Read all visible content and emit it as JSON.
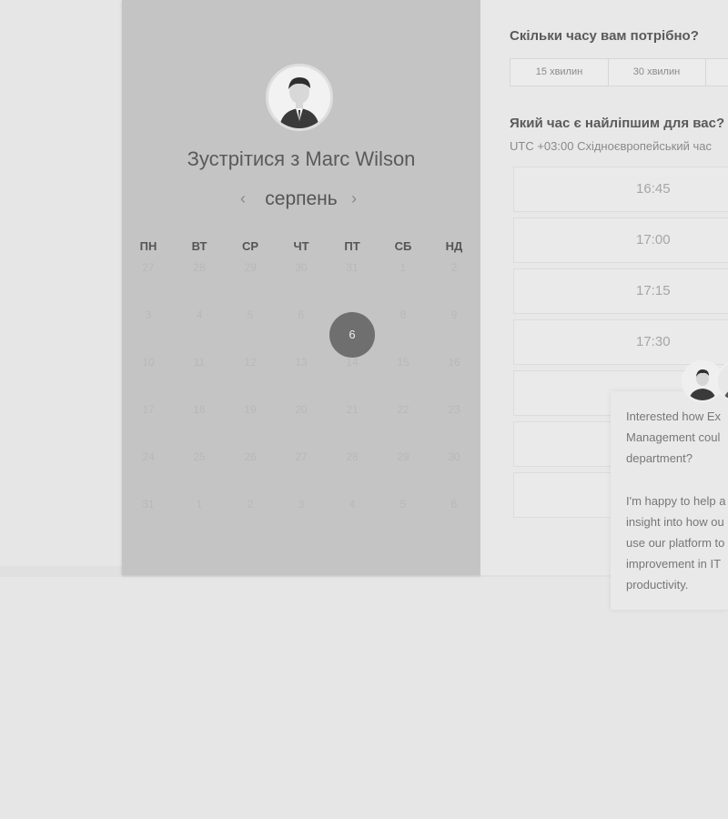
{
  "host": {
    "title": "Зустрітися з Marc Wilson"
  },
  "calendar": {
    "prev_symbol": "‹",
    "next_symbol": "›",
    "month": "серпень",
    "weekdays": [
      "ПН",
      "ВТ",
      "СР",
      "ЧТ",
      "ПТ",
      "СБ",
      "НД"
    ],
    "weeks": [
      [
        "27",
        "28",
        "29",
        "30",
        "31",
        "1",
        "2"
      ],
      [
        "3",
        "4",
        "5",
        "6",
        "7",
        "8",
        "9"
      ],
      [
        "10",
        "11",
        "12",
        "13",
        "14",
        "15",
        "16"
      ],
      [
        "17",
        "18",
        "19",
        "20",
        "21",
        "22",
        "23"
      ],
      [
        "24",
        "25",
        "26",
        "27",
        "28",
        "29",
        "30"
      ],
      [
        "31",
        "1",
        "2",
        "3",
        "4",
        "5",
        "6"
      ]
    ],
    "selected_day": "6"
  },
  "booking": {
    "duration_question": "Скільки часу вам потрібно?",
    "durations": [
      "15 хвилин",
      "30 хвилин"
    ],
    "time_question": "Який час є найліпшим для вас?",
    "timezone": "UTC +03:00 Східноєвропейський час",
    "slots": [
      "16:45",
      "17:00",
      "17:15",
      "17:30"
    ]
  },
  "chat": {
    "lines": [
      "Interested how Ex",
      "Management coul",
      "department?",
      "I'm happy to help a",
      "insight into how ou",
      "use our platform to",
      "improvement in IT",
      "productivity."
    ]
  },
  "colors": {
    "panel": "#c4c4c4",
    "selected_day": "#6f6f6f",
    "background": "#e6e6e6"
  }
}
